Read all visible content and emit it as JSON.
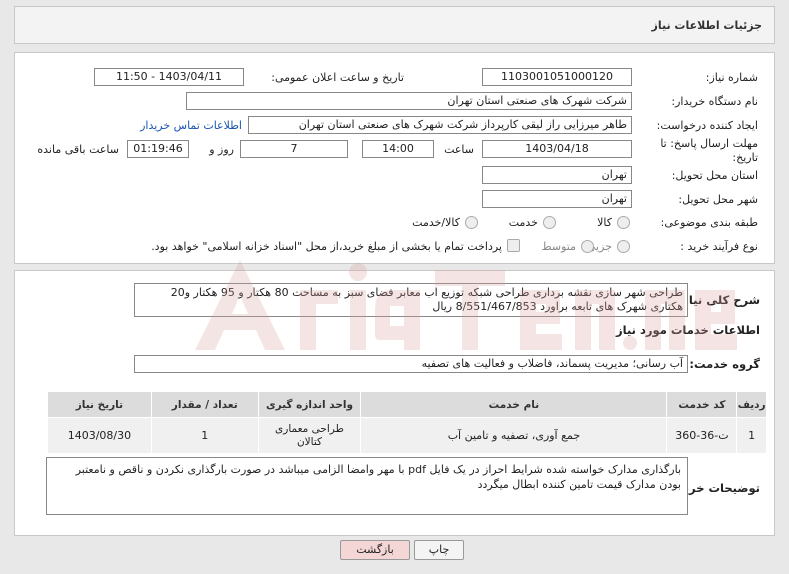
{
  "header": {
    "title": "جزئیات اطلاعات نیاز"
  },
  "form": {
    "need_number_label": "شماره نیاز:",
    "need_number": "1103001051000120",
    "announce_label": "تاریخ و ساعت اعلان عمومی:",
    "announce_value": "1403/04/11 - 11:50",
    "buyer_label": "نام دستگاه خریدار:",
    "buyer_value": "شرکت شهرک های صنعتی استان تهران",
    "creator_label": "ایجاد کننده درخواست:",
    "creator_value": "طاهر  میرزایی راز لیقی کارپرداز شرکت شهرک های صنعتی استان تهران",
    "contact_link": "اطلاعات تماس خریدار",
    "deadline_label": "مهلت ارسال پاسخ: تا تاریخ:",
    "deadline_date": "1403/04/18",
    "time_label": "ساعت",
    "deadline_time": "14:00",
    "days_value": "7",
    "days_label": "روز و",
    "remaining_time": "01:19:46",
    "remaining_label": "ساعت باقی مانده",
    "province_label": "استان محل تحویل:",
    "province_value": "تهران",
    "city_label": "شهر محل تحویل:",
    "city_value": "تهران",
    "category_label": "طبقه بندی موضوعی:",
    "category_options": [
      "کالا",
      "خدمت",
      "کالا/خدمت"
    ],
    "process_label": "نوع فرآیند خرید :",
    "process_options": [
      "جزیی",
      "متوسط"
    ],
    "payment_note": "پرداخت تمام یا بخشی از مبلغ خرید،از محل \"اسناد خزانه اسلامی\" خواهد بود."
  },
  "description": {
    "summary_label": "شرح کلی نیاز:",
    "summary_text": "طراحی شهر سازی نقشه برداری طراحی شبکه توزیع اب معابر فضای سبز به مساحت 80 هکتار و 95 هکتار و20 هکتاری شهرک های تابعه براورد 8/551/467/853 ریال",
    "services_title": "اطلاعات خدمات مورد نیاز",
    "service_group_label": "گروه خدمت:",
    "service_group_value": "آب رسانی؛ مدیریت پسماند، فاضلاب و فعالیت های تصفیه",
    "table_headers": [
      "ردیف",
      "کد خدمت",
      "نام خدمت",
      "واحد اندازه گیری",
      "تعداد / مقدار",
      "تاریخ نیاز"
    ],
    "table_rows": [
      {
        "row": "1",
        "code": "ت-36-360",
        "name": "جمع آوری، تصفیه و تامین آب",
        "unit": "طراحی معماری کتالان",
        "qty": "1",
        "date": "1403/08/30"
      }
    ],
    "buyer_notes_label": "توضیحات خریدار:",
    "buyer_notes": "بارگذاری مدارک خواسته شده  شرایط احراز در یک فایل pdf  با مهر وامضا الزامی میباشد در صورت بارگذاری نکردن و ناقص و نامعتبر بودن مدارک قیمت تامین کننده ابطال میگردد"
  },
  "buttons": {
    "print": "چاپ",
    "back": "بازگشت"
  },
  "colors": {
    "link": "#1a55b0",
    "back_button": "#f4d6d6",
    "watermark": "#d9a0a0"
  }
}
